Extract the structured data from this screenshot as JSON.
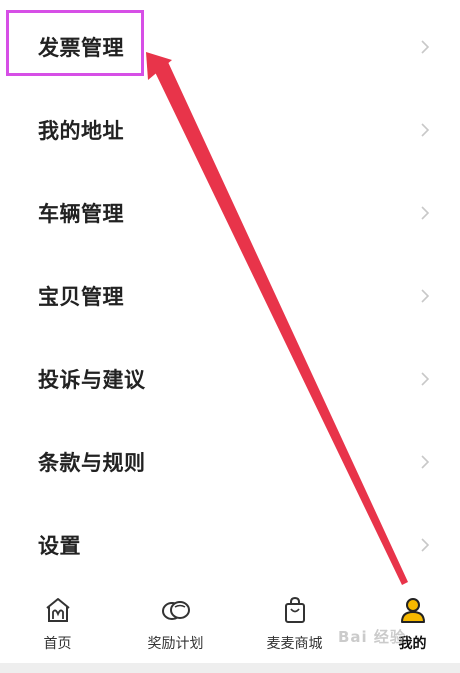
{
  "menu": {
    "items": [
      {
        "label": "发票管理"
      },
      {
        "label": "我的地址"
      },
      {
        "label": "车辆管理"
      },
      {
        "label": "宝贝管理"
      },
      {
        "label": "投诉与建议"
      },
      {
        "label": "条款与规则"
      },
      {
        "label": "设置"
      }
    ]
  },
  "tabbar": {
    "tabs": [
      {
        "label": "首页",
        "icon": "home-icon"
      },
      {
        "label": "奖励计划",
        "icon": "coins-icon"
      },
      {
        "label": "麦麦商城",
        "icon": "shopping-bag-icon"
      },
      {
        "label": "我的",
        "icon": "user-icon",
        "active": true
      }
    ]
  },
  "colors": {
    "highlight": "#d64fe6",
    "arrow": "#e8344a",
    "accent": "#f5b800"
  },
  "watermark": "Bai 经验"
}
